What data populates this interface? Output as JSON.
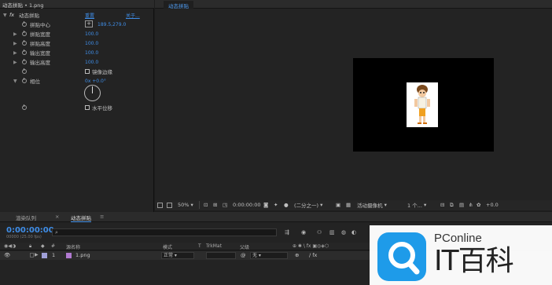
{
  "effect_controls": {
    "header": "动态拼贴 • 1.png",
    "effect_name": "动态拼贴",
    "reset_label": "重置",
    "about_label": "关于...",
    "properties": [
      {
        "label": "拼贴中心",
        "value": "189.5,279.0",
        "has_crosshair": true
      },
      {
        "label": "拼贴宽度",
        "value": "100.0"
      },
      {
        "label": "拼贴高度",
        "value": "100.0"
      },
      {
        "label": "输出宽度",
        "value": "100.0"
      },
      {
        "label": "输出高度",
        "value": "100.0"
      },
      {
        "label": "镜像边缘",
        "type": "checkbox",
        "checked": false
      },
      {
        "label": "相位",
        "value": "0x +0.0°",
        "expanded": true
      },
      {
        "label": "水平位移",
        "type": "checkbox",
        "checked": false
      }
    ]
  },
  "viewer": {
    "tab": "动态拼贴",
    "toolbar": {
      "zoom": "50%",
      "timecode": "0:00:00:00",
      "resolution": "(二分之一)",
      "camera": "活动摄像机",
      "views": "1 个...",
      "exposure": "+0.0"
    }
  },
  "timeline": {
    "tabs": [
      "渲染队列",
      "动态拼贴"
    ],
    "timecode": "0:00:00:00",
    "timecode_sub": "00000 (25.00 fps)",
    "search_icon": "search-icon",
    "columns": {
      "num": "#",
      "source": "源名称",
      "mode": "模式",
      "t": "T",
      "trkmat": "TrkMat",
      "parent": "父级"
    },
    "layer": {
      "index": "1",
      "name": "1.png",
      "mode": "正常",
      "parent": "无"
    }
  },
  "watermark": {
    "brand_small": "PConline",
    "brand_big": "IT百科"
  },
  "colors": {
    "accent_blue": "#3f8ee8",
    "watermark_blue": "#1e9be9",
    "panel": "#232323"
  }
}
